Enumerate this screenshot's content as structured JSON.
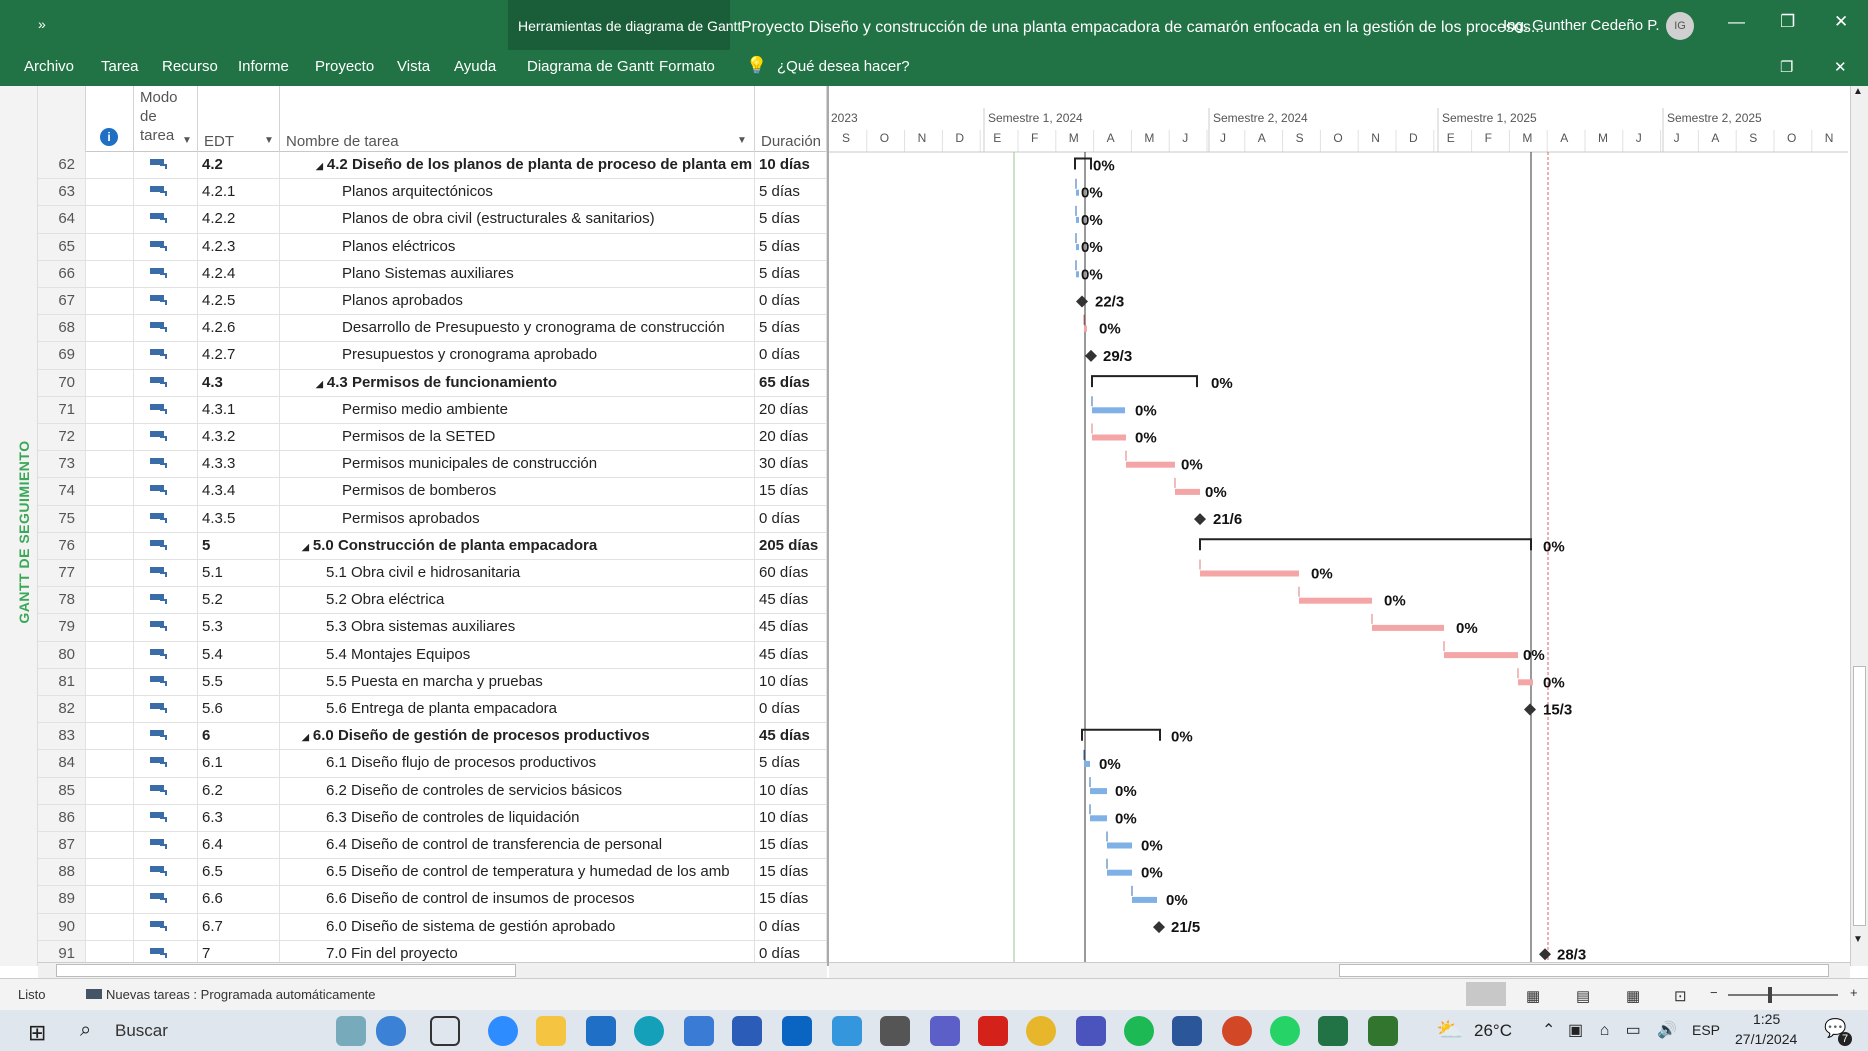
{
  "titlebar": {
    "qat": "»",
    "context_tab": "Herramientas de diagrama de Gantt",
    "title": "Proyecto Diseño y construcción de una planta empacadora de camarón enfocada en la gestión de los procesos...",
    "user": "Ing. Gunther Cedeño P.",
    "avatar": "IG"
  },
  "menu": {
    "items": [
      "Archivo",
      "Tarea",
      "Recurso",
      "Informe",
      "Proyecto",
      "Vista",
      "Ayuda"
    ],
    "context_items": [
      "Diagrama de Gantt",
      "Formato"
    ],
    "tell_me": "¿Qué desea hacer?"
  },
  "side_label": "GANTT DE SEGUIMIENTO",
  "columns": {
    "mode": "Modo de tarea",
    "edt": "EDT",
    "name": "Nombre de tarea",
    "duration": "Duración"
  },
  "rows": [
    {
      "id": "62",
      "edt": "4.2",
      "name": "4.2 Diseño de los planos de planta de proceso de planta em",
      "dur": "10 días",
      "bold": true,
      "lvl": 1
    },
    {
      "id": "63",
      "edt": "4.2.1",
      "name": "Planos arquitectónicos",
      "dur": "5 días",
      "bold": false,
      "lvl": 2
    },
    {
      "id": "64",
      "edt": "4.2.2",
      "name": "Planos de obra civil (estructurales & sanitarios)",
      "dur": "5 días",
      "bold": false,
      "lvl": 2
    },
    {
      "id": "65",
      "edt": "4.2.3",
      "name": "Planos eléctricos",
      "dur": "5 días",
      "bold": false,
      "lvl": 2
    },
    {
      "id": "66",
      "edt": "4.2.4",
      "name": "Plano Sistemas auxiliares",
      "dur": "5 días",
      "bold": false,
      "lvl": 2
    },
    {
      "id": "67",
      "edt": "4.2.5",
      "name": "Planos aprobados",
      "dur": "0 días",
      "bold": false,
      "lvl": 2
    },
    {
      "id": "68",
      "edt": "4.2.6",
      "name": "Desarrollo de Presupuesto y cronograma de construcción",
      "dur": "5 días",
      "bold": false,
      "lvl": 2
    },
    {
      "id": "69",
      "edt": "4.2.7",
      "name": "Presupuestos y cronograma aprobado",
      "dur": "0 días",
      "bold": false,
      "lvl": 2
    },
    {
      "id": "70",
      "edt": "4.3",
      "name": "4.3 Permisos de funcionamiento",
      "dur": "65 días",
      "bold": true,
      "lvl": 1
    },
    {
      "id": "71",
      "edt": "4.3.1",
      "name": "Permiso medio ambiente",
      "dur": "20 días",
      "bold": false,
      "lvl": 2
    },
    {
      "id": "72",
      "edt": "4.3.2",
      "name": "Permisos de la SETED",
      "dur": "20 días",
      "bold": false,
      "lvl": 2
    },
    {
      "id": "73",
      "edt": "4.3.3",
      "name": "Permisos municipales de construcción",
      "dur": "30 días",
      "bold": false,
      "lvl": 2
    },
    {
      "id": "74",
      "edt": "4.3.4",
      "name": "Permisos de bomberos",
      "dur": "15 días",
      "bold": false,
      "lvl": 2
    },
    {
      "id": "75",
      "edt": "4.3.5",
      "name": "Permisos aprobados",
      "dur": "0 días",
      "bold": false,
      "lvl": 2
    },
    {
      "id": "76",
      "edt": "5",
      "name": "5.0 Construcción de planta empacadora",
      "dur": "205 días",
      "bold": true,
      "lvl": 0
    },
    {
      "id": "77",
      "edt": "5.1",
      "name": "5.1 Obra civil e hidrosanitaria",
      "dur": "60 días",
      "bold": false,
      "lvl": 1
    },
    {
      "id": "78",
      "edt": "5.2",
      "name": "5.2 Obra eléctrica",
      "dur": "45 días",
      "bold": false,
      "lvl": 1
    },
    {
      "id": "79",
      "edt": "5.3",
      "name": "5.3 Obra sistemas auxiliares",
      "dur": "45 días",
      "bold": false,
      "lvl": 1
    },
    {
      "id": "80",
      "edt": "5.4",
      "name": "5.4 Montajes Equipos",
      "dur": "45 días",
      "bold": false,
      "lvl": 1
    },
    {
      "id": "81",
      "edt": "5.5",
      "name": "5.5 Puesta en marcha y pruebas",
      "dur": "10 días",
      "bold": false,
      "lvl": 1
    },
    {
      "id": "82",
      "edt": "5.6",
      "name": "5.6 Entrega de planta empacadora",
      "dur": "0 días",
      "bold": false,
      "lvl": 1
    },
    {
      "id": "83",
      "edt": "6",
      "name": "6.0 Diseño de gestión de procesos productivos",
      "dur": "45 días",
      "bold": true,
      "lvl": 0
    },
    {
      "id": "84",
      "edt": "6.1",
      "name": "6.1 Diseño flujo de procesos productivos",
      "dur": "5 días",
      "bold": false,
      "lvl": 1
    },
    {
      "id": "85",
      "edt": "6.2",
      "name": "6.2 Diseño de controles de servicios básicos",
      "dur": "10 días",
      "bold": false,
      "lvl": 1
    },
    {
      "id": "86",
      "edt": "6.3",
      "name": "6.3 Diseño de controles de liquidación",
      "dur": "10 días",
      "bold": false,
      "lvl": 1
    },
    {
      "id": "87",
      "edt": "6.4",
      "name": "6.4 Diseño de control de transferencia de personal",
      "dur": "15 días",
      "bold": false,
      "lvl": 1
    },
    {
      "id": "88",
      "edt": "6.5",
      "name": "6.5 Diseño de control de temperatura y humedad de los amb",
      "dur": "15 días",
      "bold": false,
      "lvl": 1
    },
    {
      "id": "89",
      "edt": "6.6",
      "name": "6.6 Diseño de control de insumos de procesos",
      "dur": "15 días",
      "bold": false,
      "lvl": 1
    },
    {
      "id": "90",
      "edt": "6.7",
      "name": "6.0 Diseño de sistema de gestión aprobado",
      "dur": "0 días",
      "bold": false,
      "lvl": 1
    },
    {
      "id": "91",
      "edt": "7",
      "name": "7.0 Fin del proyecto",
      "dur": "0 días",
      "bold": false,
      "lvl": 1
    }
  ],
  "timescale": {
    "top_labels": [
      "2023",
      "Semestre 1, 2024",
      "Semestre 2, 2024",
      "Semestre 1, 2025",
      "Semestre 2, 2025"
    ],
    "months": [
      "S",
      "O",
      "N",
      "D",
      "E",
      "F",
      "M",
      "A",
      "M",
      "J",
      "J",
      "A",
      "S",
      "O",
      "N",
      "D",
      "E",
      "F",
      "M",
      "A",
      "M",
      "J",
      "J",
      "A",
      "S",
      "O",
      "N"
    ]
  },
  "gantt_labels": [
    "0%",
    "0%",
    "0%",
    "0%",
    "0%",
    "22/3",
    "0%",
    "29/3",
    "0%",
    "0%",
    "0%",
    "0%",
    "0%",
    "21/6",
    "0%",
    "0%",
    "0%",
    "0%",
    "0%",
    "0%",
    "15/3",
    "0%",
    "0%",
    "0%",
    "0%",
    "0%",
    "0%",
    "0%",
    "21/5",
    "28/3"
  ],
  "status": {
    "ready": "Listo",
    "new_tasks": "Nuevas tareas : Programada automáticamente"
  },
  "taskbar": {
    "search": "Buscar",
    "weather": "26°C",
    "lang": "ESP",
    "time": "1:25",
    "date": "27/1/2024",
    "notif": "7"
  },
  "colors": {
    "ribbon": "#217346",
    "critical": "#f4a6a6",
    "normal": "#7fb1e6",
    "summary": "#222222"
  }
}
